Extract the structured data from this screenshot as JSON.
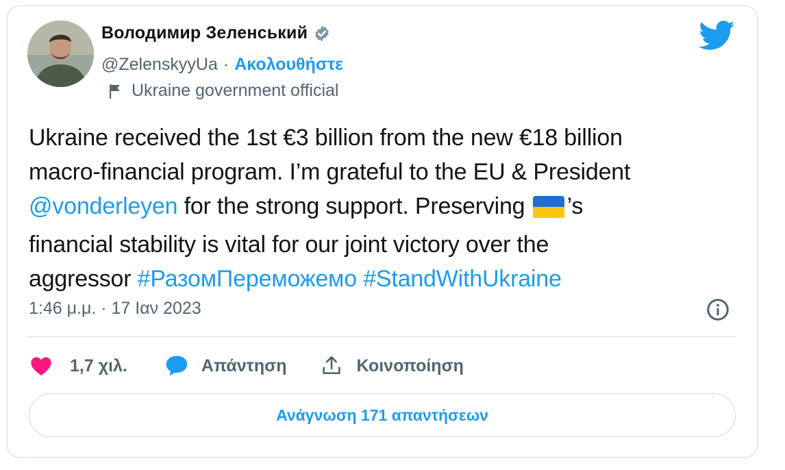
{
  "author": {
    "display_name": "Володимир Зеленський",
    "handle": "@ZelenskyyUa",
    "separator": "·",
    "follow_label": "Ακολουθήστε",
    "account_label": "Ukraine government official",
    "verified": true
  },
  "tweet": {
    "text_segments": {
      "line1": "Ukraine received the 1st €3 billion from the new €18 billion",
      "line2": "macro-financial program. I’m grateful to the EU & President",
      "mention": "@vonderleyen",
      "line3_rest": " for the strong support. Preserving ",
      "possessive": "’s",
      "line4": "financial stability is vital for our joint victory over the",
      "line5_start": "aggressor ",
      "hashtag1": "#РазомПереможемо",
      "hashtag2": "#StandWithUkraine"
    },
    "timestamp": "1:46 μ.μ. · 17 Ιαν 2023"
  },
  "actions": {
    "like_count": "1,7 χιλ.",
    "reply_label": "Απάντηση",
    "share_label": "Κοινοποίηση"
  },
  "read_replies_label": "Ανάγνωση 171 απαντήσεων",
  "icons": [
    "verified-badge-icon",
    "twitter-bird-icon",
    "flag-icon",
    "info-icon",
    "heart-icon",
    "reply-bubble-icon",
    "share-icon",
    "ukraine-flag-emoji"
  ],
  "colors": {
    "accent": "#1d9bf0",
    "like": "#f91880",
    "secondary_text": "#536471",
    "border": "#cfd9de"
  }
}
